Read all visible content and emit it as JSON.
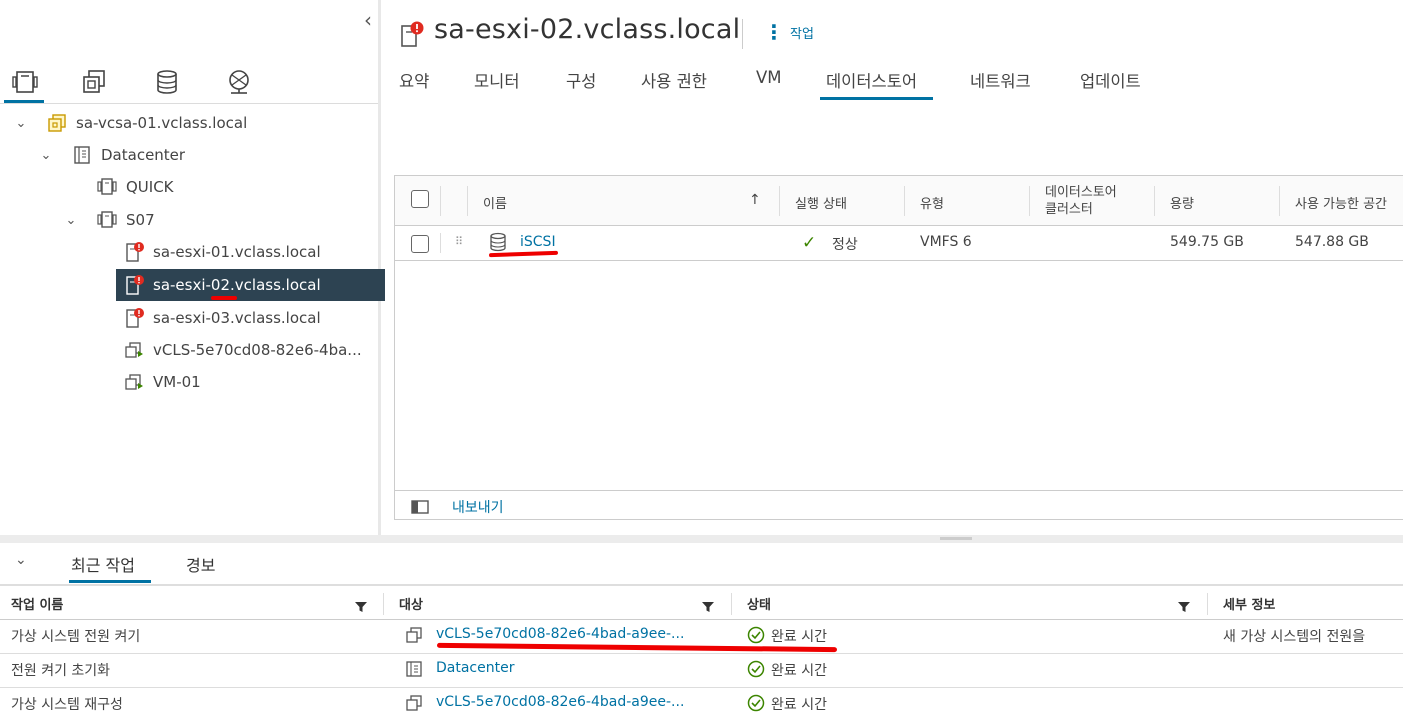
{
  "nav": {
    "collapse_glyph": "‹",
    "tabs": [
      {
        "name": "hosts-clusters-icon"
      },
      {
        "name": "vms-templates-icon"
      },
      {
        "name": "storage-icon"
      },
      {
        "name": "networking-icon"
      }
    ],
    "tree": [
      {
        "label": "sa-vcsa-01.vclass.local",
        "icon": "vcenter-icon",
        "expanded": true
      },
      {
        "label": "Datacenter",
        "icon": "datacenter-icon",
        "expanded": true
      },
      {
        "label": "QUICK",
        "icon": "cluster-icon"
      },
      {
        "label": "S07",
        "icon": "cluster-icon",
        "expanded": true
      },
      {
        "label": "sa-esxi-01.vclass.local",
        "icon": "host-alert-icon"
      },
      {
        "label": "sa-esxi-02.vclass.local",
        "icon": "host-alert-icon",
        "selected": true
      },
      {
        "label": "sa-esxi-03.vclass.local",
        "icon": "host-alert-icon"
      },
      {
        "label": "vCLS-5e70cd08-82e6-4ba...",
        "icon": "vm-icon"
      },
      {
        "label": "VM-01",
        "icon": "vm-icon"
      }
    ]
  },
  "header": {
    "title": "sa-esxi-02.vclass.local",
    "actions_label": "작업",
    "tabs": [
      "요약",
      "모니터",
      "구성",
      "사용 권한",
      "VM",
      "데이터스토어",
      "네트워크",
      "업데이트"
    ],
    "active_tab": "데이터스토어"
  },
  "grid": {
    "columns": {
      "name": "이름",
      "status": "실행 상태",
      "type": "유형",
      "cluster_line1": "데이터스토어",
      "cluster_line2": "클러스터",
      "capacity": "용량",
      "free": "사용 가능한 공간"
    },
    "sort_glyph": "↑",
    "rows": [
      {
        "name": "iSCSI",
        "status": "정상",
        "type": "VMFS 6",
        "cluster": "",
        "capacity": "549.75 GB",
        "free": "547.88 GB"
      }
    ],
    "export_label": "내보내기"
  },
  "tasks": {
    "collapse_glyph": "⌄",
    "tabs": [
      "최근 작업",
      "경보"
    ],
    "columns": {
      "task": "작업 이름",
      "target": "대상",
      "status": "상태",
      "details": "세부 정보"
    },
    "rows": [
      {
        "task": "가상 시스템 전원 켜기",
        "target": "vCLS-5e70cd08-82e6-4bad-a9ee-...",
        "target_icon": "vm-icon",
        "status": "완료 시간",
        "details": "새 가상 시스템의 전원을"
      },
      {
        "task": "전원 켜기 초기화",
        "target": "Datacenter",
        "target_icon": "datacenter-icon",
        "status": "완료 시간",
        "details": ""
      },
      {
        "task": "가상 시스템 재구성",
        "target": "vCLS-5e70cd08-82e6-4bad-a9ee-...",
        "target_icon": "vm-icon",
        "status": "완료 시간",
        "details": ""
      }
    ]
  },
  "colors": {
    "accent": "#0072a3",
    "selected_bg": "#2d4352",
    "alert": "#e02b20",
    "ok": "#3c8500",
    "annotation": "#e00000"
  }
}
